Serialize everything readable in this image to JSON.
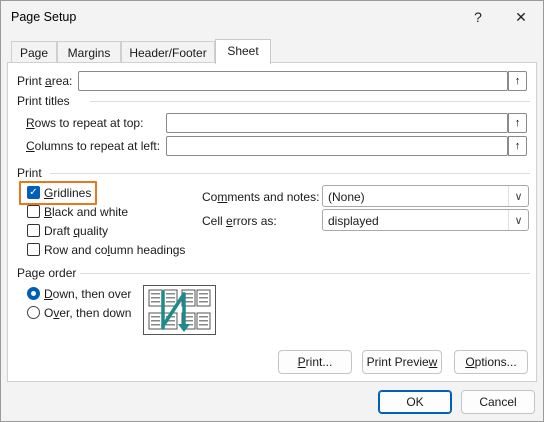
{
  "window": {
    "title": "Page Setup",
    "help_glyph": "?",
    "close_glyph": "✕"
  },
  "tabs": [
    {
      "label": "Page",
      "active": false
    },
    {
      "label": "Margins",
      "active": false
    },
    {
      "label": "Header/Footer",
      "active": false
    },
    {
      "label": "Sheet",
      "active": true
    }
  ],
  "print_area": {
    "label_pre": "Print ",
    "label_u": "a",
    "label_post": "rea:",
    "value": "",
    "button_glyph": "↑"
  },
  "print_titles": {
    "heading": "Print titles",
    "rows": {
      "label_u": "R",
      "label_post": "ows to repeat at top:",
      "value": "",
      "button_glyph": "↑"
    },
    "columns": {
      "label_u": "C",
      "label_post": "olumns to repeat at left:",
      "value": "",
      "button_glyph": "↑"
    }
  },
  "print": {
    "heading": "Print",
    "gridlines": {
      "label_u": "G",
      "label_post": "ridlines",
      "checked": true,
      "check_glyph": "✓"
    },
    "black_white": {
      "label_u": "B",
      "label_post": "lack and white",
      "checked": false
    },
    "draft": {
      "label_pre": "Draft ",
      "label_u": "q",
      "label_post": "uality",
      "checked": false
    },
    "headings": {
      "label_pre": "Row and co",
      "label_u": "l",
      "label_post": "umn headings",
      "checked": false
    },
    "comments": {
      "label_pre": "Co",
      "label_u": "m",
      "label_post": "ments and notes:",
      "value": "(None)"
    },
    "cell_errors": {
      "label_pre": "Cell ",
      "label_u": "e",
      "label_post": "rrors as:",
      "value": "displayed"
    },
    "dropdown_glyph": "∨"
  },
  "page_order": {
    "heading": "Page order",
    "down_over": {
      "label_u": "D",
      "label_post": "own, then over",
      "selected": true
    },
    "over_down": {
      "label_pre": "O",
      "label_u": "v",
      "label_post": "er, then down",
      "selected": false
    },
    "icon": "page-order-down-then-over-icon"
  },
  "buttons": {
    "print": {
      "label_u": "P",
      "label_post": "rint..."
    },
    "print_preview": {
      "label_pre": "Print Previe",
      "label_u": "w",
      "label_post": ""
    },
    "options": {
      "label_u": "O",
      "label_post": "ptions..."
    },
    "ok": "OK",
    "cancel": "Cancel"
  },
  "colors": {
    "accent": "#005fb8",
    "highlight": "#e87722",
    "diagram_arrow": "#1f8a8a"
  }
}
